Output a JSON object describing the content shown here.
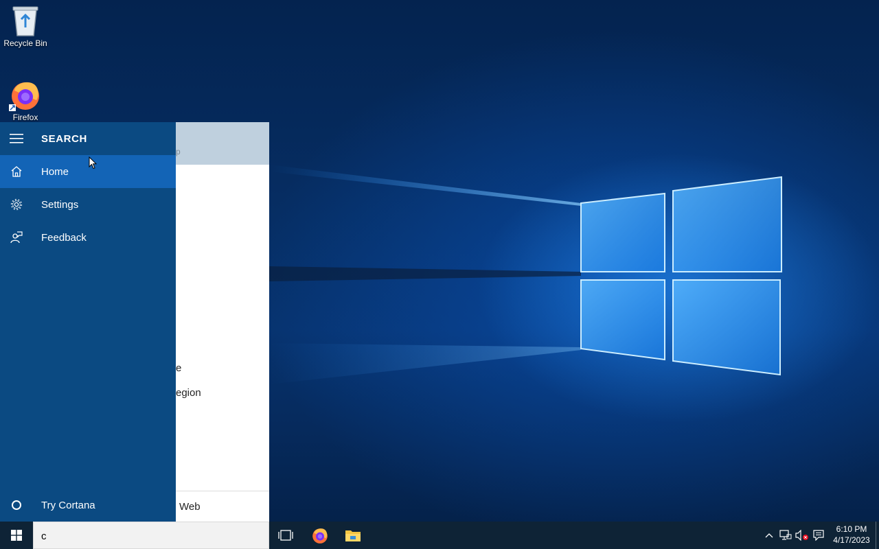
{
  "desktop": {
    "icons": [
      {
        "label": "Recycle Bin",
        "icon": "recycle-bin-icon"
      },
      {
        "label": "Firefox",
        "icon": "firefox-icon"
      }
    ]
  },
  "search_panel": {
    "nav_header": "SEARCH",
    "nav_items": [
      {
        "label": "Home",
        "icon": "home-icon",
        "selected": true
      },
      {
        "label": "Settings",
        "icon": "gear-icon"
      },
      {
        "label": "Feedback",
        "icon": "feedback-icon"
      }
    ],
    "cortana_label": "Try Cortana",
    "results_header_fragment": "p",
    "result_fragments": [
      "e",
      "egion"
    ],
    "web_footer_label": "Web"
  },
  "taskbar": {
    "search_value": "c",
    "pinned": [
      {
        "name": "task-view",
        "icon": "task-view-icon"
      },
      {
        "name": "firefox",
        "icon": "firefox-icon"
      },
      {
        "name": "file-explorer",
        "icon": "folder-icon"
      }
    ],
    "clock": {
      "time": "6:10 PM",
      "date": "4/17/2023"
    }
  },
  "colors": {
    "nav_bg": "#0b4a82",
    "nav_selected": "#1364b6",
    "taskbar_bg": "#0e2336",
    "results_header": "#bfd0de"
  }
}
